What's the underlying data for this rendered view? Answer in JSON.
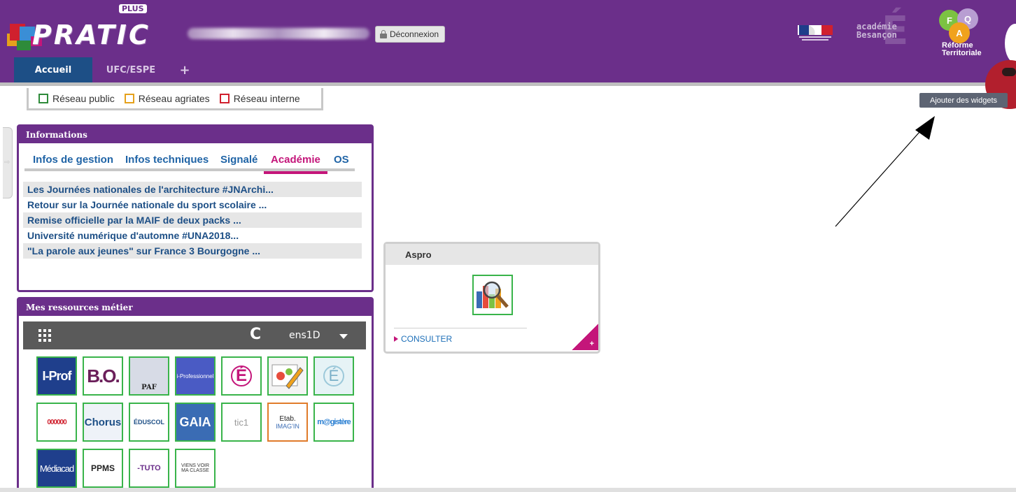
{
  "header": {
    "logo_text": "PRATIC",
    "logo_badge": "PLUS",
    "logout_label": "Déconnexion",
    "academie_line1": "académie",
    "academie_line2": "Besançon",
    "reforme_line1": "Réforme",
    "reforme_line2": "Territoriale",
    "reforme_letters": [
      "F",
      "Q",
      "A"
    ],
    "colors": {
      "bar": "#6b2f8a",
      "tab_active": "#1d4f86"
    }
  },
  "tabs": [
    {
      "label": "Accueil",
      "active": true
    },
    {
      "label": "UFC/ESPE",
      "active": false
    },
    {
      "label": "+",
      "active": false
    }
  ],
  "legend": [
    {
      "label": "Réseau public",
      "color": "#2e8b3a"
    },
    {
      "label": "Réseau agriates",
      "color": "#e5a11c"
    },
    {
      "label": "Réseau interne",
      "color": "#d0202e"
    }
  ],
  "add_widgets_label": "Ajouter des widgets",
  "informations": {
    "title": "Informations",
    "tabs": [
      "Infos de gestion",
      "Infos techniques",
      "Signalé",
      "Académie",
      "OS"
    ],
    "active_tab": "Académie",
    "news": [
      "Les Journées nationales de l'architecture #JNArchi...",
      "Retour sur la Journée nationale du sport scolaire ...",
      "Remise officielle par la MAIF de deux packs ...",
      "Université numérique d'automne #UNA2018...",
      "\"La parole aux jeunes\" sur France 3 Bourgogne ..."
    ]
  },
  "ressources": {
    "title": "Mes ressources métier",
    "selected_profile": "ens1D",
    "tiles": [
      {
        "label": "I-Prof"
      },
      {
        "label": "B.O."
      },
      {
        "label": "PAF"
      },
      {
        "label": "i-Professionnel"
      },
      {
        "label": "É"
      },
      {
        "label": ""
      },
      {
        "label": "É"
      },
      {
        "label": "000000"
      },
      {
        "label": "Chorus"
      },
      {
        "label": "ÉDUSCOL"
      },
      {
        "label": "GAIA"
      },
      {
        "label": "tic1"
      },
      {
        "label": "Etab.",
        "sub": "IMAG'IN"
      },
      {
        "label": "m@gistère"
      },
      {
        "label": "Médiacad"
      },
      {
        "label": "PPMS"
      },
      {
        "label": "-TUTO"
      },
      {
        "label": "VIENS VOIR",
        "sub": "MA CLASSE"
      }
    ]
  },
  "aspro": {
    "title": "Aspro",
    "link_label": "CONSULTER",
    "corner_label": "+"
  }
}
